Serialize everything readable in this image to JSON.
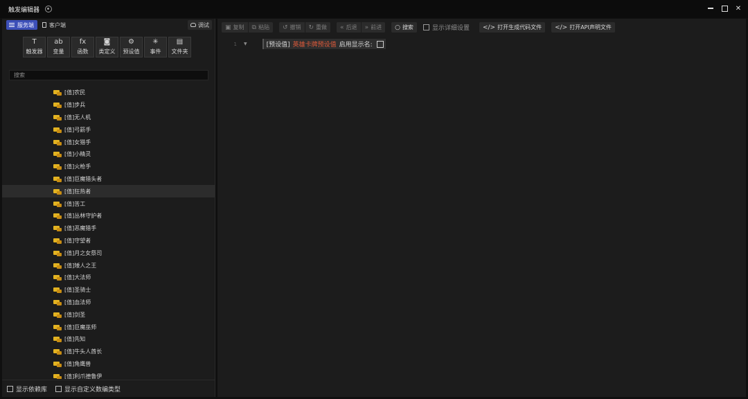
{
  "window": {
    "title": "触发编辑器"
  },
  "left": {
    "tabs": [
      {
        "label": "服务端",
        "active": true
      },
      {
        "label": "客户端",
        "active": false
      }
    ],
    "debug_label": "调试",
    "tools": [
      {
        "label": "触发器",
        "icon": "T"
      },
      {
        "label": "变量",
        "icon": "ab"
      },
      {
        "label": "函数",
        "icon": "fx"
      },
      {
        "label": "类定义",
        "icon": "◙"
      },
      {
        "label": "预设值",
        "icon": "⚙"
      },
      {
        "label": "事件",
        "icon": "✳"
      },
      {
        "label": "文件夹",
        "icon": "▤"
      }
    ],
    "search_placeholder": "搜索",
    "tree_items": [
      "[值]农民",
      "[值]步兵",
      "[值]无人机",
      "[值]弓箭手",
      "[值]女猎手",
      "[值]小精灵",
      "[值]火枪手",
      "[值]巨魔猎头者",
      "[值]狂热者",
      "[值]苦工",
      "[值]丛林守护者",
      "[值]恶魔猎手",
      "[值]守望者",
      "[值]月之女祭司",
      "[值]矮人之王",
      "[值]大法师",
      "[值]圣骑士",
      "[值]血法师",
      "[值]剑圣",
      "[值]巨魔巫师",
      "[值]先知",
      "[值]牛头人酋长",
      "[值]角鹰兽",
      "[值]利爪德鲁伊"
    ],
    "selected_index": 8,
    "footer": {
      "show_deps": "显示依赖库",
      "show_custom_types": "显示自定义数编类型"
    }
  },
  "toolbar": {
    "copy": "复制",
    "paste": "粘贴",
    "undo": "撤销",
    "redo": "重做",
    "back": "后退",
    "forward": "前进",
    "search": "搜索",
    "show_detail": "显示详细设置",
    "open_generated": "打开生成代码文件",
    "open_api": "打开API声明文件"
  },
  "editor": {
    "line_number": "1",
    "tag": "[预设值]",
    "name": "英雄卡牌预设值",
    "label": "启用显示名:"
  }
}
